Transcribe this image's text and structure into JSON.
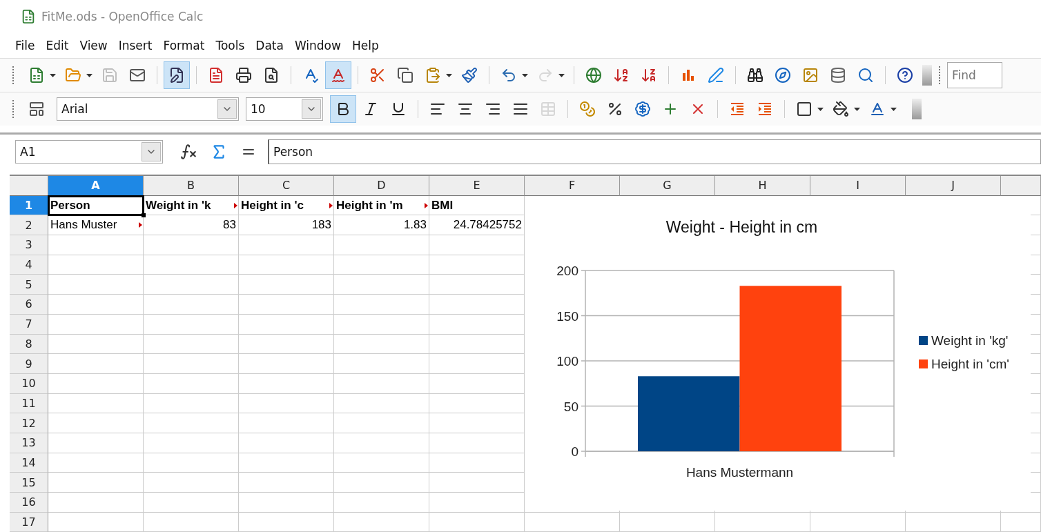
{
  "window": {
    "title": "FitMe.ods - OpenOffice Calc"
  },
  "menu": [
    {
      "label": "File"
    },
    {
      "label": "Edit"
    },
    {
      "label": "View"
    },
    {
      "label": "Insert"
    },
    {
      "label": "Format"
    },
    {
      "label": "Tools"
    },
    {
      "label": "Data"
    },
    {
      "label": "Window"
    },
    {
      "label": "Help"
    }
  ],
  "standard_toolbar": {
    "buttons": [
      {
        "pressed": false,
        "disabled": false
      },
      {
        "pressed": false,
        "disabled": false
      },
      {
        "pressed": false,
        "disabled": true
      },
      {
        "pressed": false,
        "disabled": false
      },
      {
        "pressed": true,
        "disabled": false
      },
      {
        "pressed": false,
        "disabled": false
      },
      {
        "pressed": false,
        "disabled": false
      },
      {
        "pressed": false,
        "disabled": false
      },
      {
        "pressed": false,
        "disabled": false
      },
      {
        "pressed": true,
        "disabled": false
      },
      {
        "pressed": false,
        "disabled": false
      },
      {
        "pressed": false,
        "disabled": false
      },
      {
        "pressed": false,
        "disabled": false
      },
      {
        "pressed": false,
        "disabled": false
      },
      {
        "pressed": false,
        "disabled": false
      },
      {
        "pressed": false,
        "disabled": true
      },
      {
        "pressed": false,
        "disabled": false
      },
      {
        "pressed": false,
        "disabled": false
      },
      {
        "pressed": false,
        "disabled": false
      },
      {
        "pressed": false,
        "disabled": false
      },
      {
        "pressed": false,
        "disabled": false
      },
      {
        "pressed": false,
        "disabled": false
      },
      {
        "pressed": false,
        "disabled": false
      },
      {
        "pressed": false,
        "disabled": false
      },
      {
        "pressed": false,
        "disabled": false
      },
      {
        "pressed": false,
        "disabled": false
      },
      {
        "pressed": false,
        "disabled": false
      }
    ],
    "find": {
      "placeholder": "Find"
    }
  },
  "formatting_toolbar": {
    "font_name": "Arial",
    "font_size": "10",
    "buttons": [
      {
        "pressed": false,
        "disabled": false
      },
      {
        "pressed": true,
        "disabled": false
      },
      {
        "pressed": false,
        "disabled": false
      },
      {
        "pressed": false,
        "disabled": false
      },
      {
        "pressed": false,
        "disabled": false
      },
      {
        "pressed": false,
        "disabled": false
      },
      {
        "pressed": false,
        "disabled": false
      },
      {
        "pressed": false,
        "disabled": false
      },
      {
        "pressed": false,
        "disabled": true
      },
      {
        "pressed": false,
        "disabled": false
      },
      {
        "pressed": false,
        "disabled": false
      },
      {
        "pressed": false,
        "disabled": false
      },
      {
        "pressed": false,
        "disabled": false
      },
      {
        "pressed": false,
        "disabled": false
      },
      {
        "pressed": false,
        "disabled": false
      },
      {
        "pressed": false,
        "disabled": false
      },
      {
        "pressed": false,
        "disabled": false
      },
      {
        "pressed": false,
        "disabled": false
      },
      {
        "pressed": false,
        "disabled": false
      }
    ]
  },
  "formula_bar": {
    "name_box": "A1",
    "value": "Person"
  },
  "sheet": {
    "columns": [
      {
        "label": "A",
        "selected": true
      },
      {
        "label": "B",
        "selected": false
      },
      {
        "label": "C",
        "selected": false
      },
      {
        "label": "D",
        "selected": false
      },
      {
        "label": "E",
        "selected": false
      },
      {
        "label": "F",
        "selected": false
      },
      {
        "label": "G",
        "selected": false
      },
      {
        "label": "H",
        "selected": false
      },
      {
        "label": "I",
        "selected": false
      },
      {
        "label": "J",
        "selected": false
      }
    ],
    "rows": [
      {
        "label": "1",
        "selected": true,
        "cells": [
          {
            "text": "Person",
            "bold": true,
            "overflow": false,
            "active": true
          },
          {
            "text": "Weight in 'k",
            "bold": true,
            "overflow": true,
            "active": false
          },
          {
            "text": "Height in 'c",
            "bold": true,
            "overflow": true,
            "active": false
          },
          {
            "text": "Height in 'm",
            "bold": true,
            "overflow": true,
            "active": false
          },
          {
            "text": "BMI",
            "bold": true,
            "overflow": false,
            "active": false
          }
        ]
      },
      {
        "label": "2",
        "selected": false,
        "cells": [
          {
            "text": "Hans Muster",
            "bold": false,
            "overflow": true,
            "active": false
          },
          {
            "text": "83",
            "bold": false,
            "overflow": false,
            "active": false
          },
          {
            "text": "183",
            "bold": false,
            "overflow": false,
            "active": false
          },
          {
            "text": "1.83",
            "bold": false,
            "overflow": false,
            "active": false
          },
          {
            "text": "24.78425752",
            "bold": false,
            "overflow": false,
            "active": false
          }
        ]
      },
      {
        "label": "3",
        "selected": false
      },
      {
        "label": "4",
        "selected": false
      },
      {
        "label": "5",
        "selected": false
      },
      {
        "label": "6",
        "selected": false
      },
      {
        "label": "7",
        "selected": false
      },
      {
        "label": "8",
        "selected": false
      },
      {
        "label": "9",
        "selected": false
      },
      {
        "label": "10",
        "selected": false
      },
      {
        "label": "11",
        "selected": false
      },
      {
        "label": "12",
        "selected": false
      },
      {
        "label": "13",
        "selected": false
      },
      {
        "label": "14",
        "selected": false
      },
      {
        "label": "15",
        "selected": false
      },
      {
        "label": "16",
        "selected": false
      },
      {
        "label": "17",
        "selected": false
      }
    ],
    "chart": {
      "chart_data": {
        "type": "bar",
        "title": "Weight - Height in cm",
        "categories": [
          "Hans Mustermann"
        ],
        "series": [
          {
            "name": "Weight in 'kg'",
            "color": "#004586",
            "values": [
              83
            ]
          },
          {
            "name": "Height in 'cm'",
            "color": "#ff420e",
            "values": [
              183
            ]
          }
        ],
        "ylim": [
          0,
          200
        ],
        "yticks": [
          0,
          50,
          100,
          150,
          200
        ],
        "grid": true,
        "legend": "right"
      }
    }
  }
}
